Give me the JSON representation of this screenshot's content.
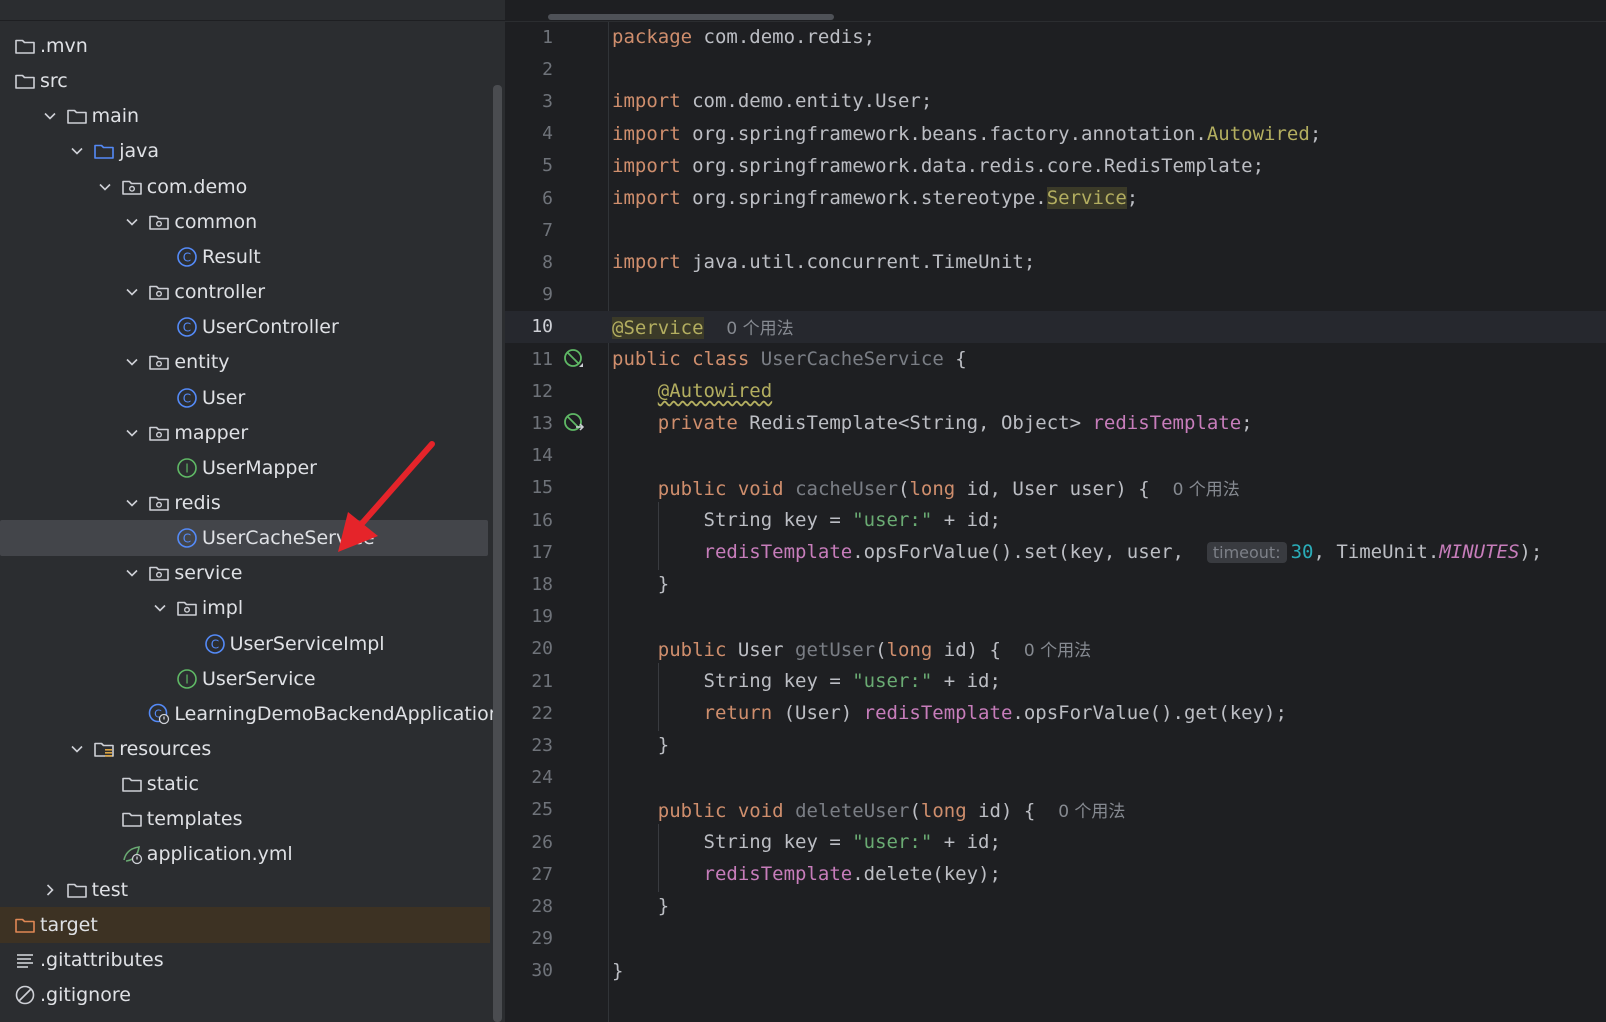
{
  "project_tree": {
    "items": [
      {
        "label": ".mvn",
        "icon": "folder-icon",
        "depth": 0,
        "arrow": "none"
      },
      {
        "label": "src",
        "icon": "folder-icon",
        "depth": 0,
        "arrow": "none"
      },
      {
        "label": "main",
        "icon": "folder-icon",
        "depth": 1,
        "arrow": "down"
      },
      {
        "label": "java",
        "icon": "source-folder-icon",
        "depth": 2,
        "arrow": "down"
      },
      {
        "label": "com.demo",
        "icon": "package-icon",
        "depth": 3,
        "arrow": "down"
      },
      {
        "label": "common",
        "icon": "package-icon",
        "depth": 4,
        "arrow": "down"
      },
      {
        "label": "Result",
        "icon": "class-icon",
        "depth": 5,
        "arrow": "none"
      },
      {
        "label": "controller",
        "icon": "package-icon",
        "depth": 4,
        "arrow": "down"
      },
      {
        "label": "UserController",
        "icon": "class-icon",
        "depth": 5,
        "arrow": "none"
      },
      {
        "label": "entity",
        "icon": "package-icon",
        "depth": 4,
        "arrow": "down"
      },
      {
        "label": "User",
        "icon": "class-icon",
        "depth": 5,
        "arrow": "none"
      },
      {
        "label": "mapper",
        "icon": "package-icon",
        "depth": 4,
        "arrow": "down"
      },
      {
        "label": "UserMapper",
        "icon": "interface-icon",
        "depth": 5,
        "arrow": "none"
      },
      {
        "label": "redis",
        "icon": "package-icon",
        "depth": 4,
        "arrow": "down"
      },
      {
        "label": "UserCacheService",
        "icon": "class-icon",
        "depth": 5,
        "arrow": "none",
        "selected": true
      },
      {
        "label": "service",
        "icon": "package-icon",
        "depth": 4,
        "arrow": "down"
      },
      {
        "label": "impl",
        "icon": "package-icon",
        "depth": 5,
        "arrow": "down"
      },
      {
        "label": "UserServiceImpl",
        "icon": "class-icon",
        "depth": 6,
        "arrow": "none"
      },
      {
        "label": "UserService",
        "icon": "interface-icon",
        "depth": 5,
        "arrow": "none"
      },
      {
        "label": "LearningDemoBackendApplication",
        "icon": "spring-boot-class-icon",
        "depth": 4,
        "arrow": "none"
      },
      {
        "label": "resources",
        "icon": "resources-folder-icon",
        "depth": 2,
        "arrow": "down"
      },
      {
        "label": "static",
        "icon": "folder-icon",
        "depth": 3,
        "arrow": "none"
      },
      {
        "label": "templates",
        "icon": "folder-icon",
        "depth": 3,
        "arrow": "none"
      },
      {
        "label": "application.yml",
        "icon": "spring-yml-icon",
        "depth": 3,
        "arrow": "none"
      },
      {
        "label": "test",
        "icon": "folder-icon",
        "depth": 1,
        "arrow": "right"
      },
      {
        "label": "target",
        "icon": "excluded-folder-icon",
        "depth": 0,
        "arrow": "none",
        "excluded": true
      },
      {
        "label": ".gitattributes",
        "icon": "text-file-icon",
        "depth": 0,
        "arrow": "none"
      },
      {
        "label": ".gitignore",
        "icon": "ignore-file-icon",
        "depth": 0,
        "arrow": "none"
      }
    ]
  },
  "editor": {
    "current_line": 10,
    "lines": [
      {
        "n": "1",
        "tokens": [
          [
            "kw",
            "package"
          ],
          [
            "",
            "com.demo.redis;"
          ]
        ]
      },
      {
        "n": "2",
        "tokens": []
      },
      {
        "n": "3",
        "tokens": [
          [
            "kw",
            "import"
          ],
          [
            "",
            "com.demo.entity.User;"
          ]
        ]
      },
      {
        "n": "4",
        "tokens": [
          [
            "kw",
            "import"
          ],
          [
            "",
            "org.springframework.beans.factory.annotation."
          ],
          [
            "ann",
            "Autowired"
          ],
          [
            "",
            ";"
          ]
        ]
      },
      {
        "n": "5",
        "tokens": [
          [
            "kw",
            "import"
          ],
          [
            "",
            "org.springframework.data.redis.core.RedisTemplate;"
          ]
        ]
      },
      {
        "n": "6",
        "tokens": [
          [
            "kw",
            "import"
          ],
          [
            "",
            "org.springframework.stereotype."
          ],
          [
            "ann hl",
            "Service"
          ],
          [
            "",
            ";"
          ]
        ]
      },
      {
        "n": "7",
        "tokens": []
      },
      {
        "n": "8",
        "tokens": [
          [
            "kw",
            "import"
          ],
          [
            "",
            "java.util.concurrent.TimeUnit;"
          ]
        ]
      },
      {
        "n": "9",
        "tokens": []
      },
      {
        "n": "10",
        "tokens": [
          [
            "ann hl",
            "@Service"
          ],
          [
            "",
            "  "
          ],
          [
            "hint",
            "0 个用法"
          ]
        ]
      },
      {
        "n": "11",
        "gutter": "bean-icon",
        "tokens": [
          [
            "kw",
            "public class"
          ],
          [
            "",
            " "
          ],
          [
            "unused",
            "UserCacheService"
          ],
          [
            "",
            " {"
          ]
        ]
      },
      {
        "n": "12",
        "tokens": [
          [
            "",
            "    "
          ],
          [
            "ann squig",
            "@Autowired"
          ]
        ]
      },
      {
        "n": "13",
        "gutter": "bean-goto-icon",
        "tokens": [
          [
            "",
            "    "
          ],
          [
            "kw",
            "private"
          ],
          [
            "",
            " RedisTemplate<String, Object> "
          ],
          [
            "fld",
            "redisTemplate"
          ],
          [
            "",
            ";"
          ]
        ]
      },
      {
        "n": "14",
        "tokens": []
      },
      {
        "n": "15",
        "tokens": [
          [
            "",
            "    "
          ],
          [
            "kw",
            "public void"
          ],
          [
            "",
            " "
          ],
          [
            "unused",
            "cacheUser"
          ],
          [
            "",
            "("
          ],
          [
            "kw",
            "long"
          ],
          [
            "",
            " id, User user) {  "
          ],
          [
            "hint",
            "0 个用法"
          ]
        ]
      },
      {
        "n": "16",
        "tokens": [
          [
            "",
            "        String key = "
          ],
          [
            "str",
            "\"user:\""
          ],
          [
            "",
            " + id;"
          ]
        ]
      },
      {
        "n": "17",
        "tokens": [
          [
            "",
            "        "
          ],
          [
            "fld",
            "redisTemplate"
          ],
          [
            "",
            ".opsForValue().set(key, user,  "
          ],
          [
            "inlay",
            "timeout:"
          ],
          [
            "num",
            "30"
          ],
          [
            "",
            ", TimeUnit."
          ],
          [
            "fldi",
            "MINUTES"
          ],
          [
            "",
            ");"
          ]
        ]
      },
      {
        "n": "18",
        "tokens": [
          [
            "",
            "    }"
          ]
        ]
      },
      {
        "n": "19",
        "tokens": []
      },
      {
        "n": "20",
        "tokens": [
          [
            "",
            "    "
          ],
          [
            "kw",
            "public"
          ],
          [
            "",
            " User "
          ],
          [
            "unused",
            "getUser"
          ],
          [
            "",
            "("
          ],
          [
            "kw",
            "long"
          ],
          [
            "",
            " id) {  "
          ],
          [
            "hint",
            "0 个用法"
          ]
        ]
      },
      {
        "n": "21",
        "tokens": [
          [
            "",
            "        String key = "
          ],
          [
            "str",
            "\"user:\""
          ],
          [
            "",
            " + id;"
          ]
        ]
      },
      {
        "n": "22",
        "tokens": [
          [
            "",
            "        "
          ],
          [
            "kw",
            "return"
          ],
          [
            "",
            " (User) "
          ],
          [
            "fld",
            "redisTemplate"
          ],
          [
            "",
            ".opsForValue().get(key);"
          ]
        ]
      },
      {
        "n": "23",
        "tokens": [
          [
            "",
            "    }"
          ]
        ]
      },
      {
        "n": "24",
        "tokens": []
      },
      {
        "n": "25",
        "tokens": [
          [
            "",
            "    "
          ],
          [
            "kw",
            "public void"
          ],
          [
            "",
            " "
          ],
          [
            "unused",
            "deleteUser"
          ],
          [
            "",
            "("
          ],
          [
            "kw",
            "long"
          ],
          [
            "",
            " id) {  "
          ],
          [
            "hint",
            "0 个用法"
          ]
        ]
      },
      {
        "n": "26",
        "tokens": [
          [
            "",
            "        String key = "
          ],
          [
            "str",
            "\"user:\""
          ],
          [
            "",
            " + id;"
          ]
        ]
      },
      {
        "n": "27",
        "tokens": [
          [
            "",
            "        "
          ],
          [
            "fld",
            "redisTemplate"
          ],
          [
            "",
            ".delete(key);"
          ]
        ]
      },
      {
        "n": "28",
        "tokens": [
          [
            "",
            "    }"
          ]
        ]
      },
      {
        "n": "29",
        "tokens": []
      },
      {
        "n": "30",
        "tokens": [
          [
            "",
            "}"
          ]
        ]
      }
    ]
  },
  "annotation": {
    "color": "#e5242a",
    "icon": "red-arrow-annotation",
    "points_to": "UserCacheService"
  }
}
